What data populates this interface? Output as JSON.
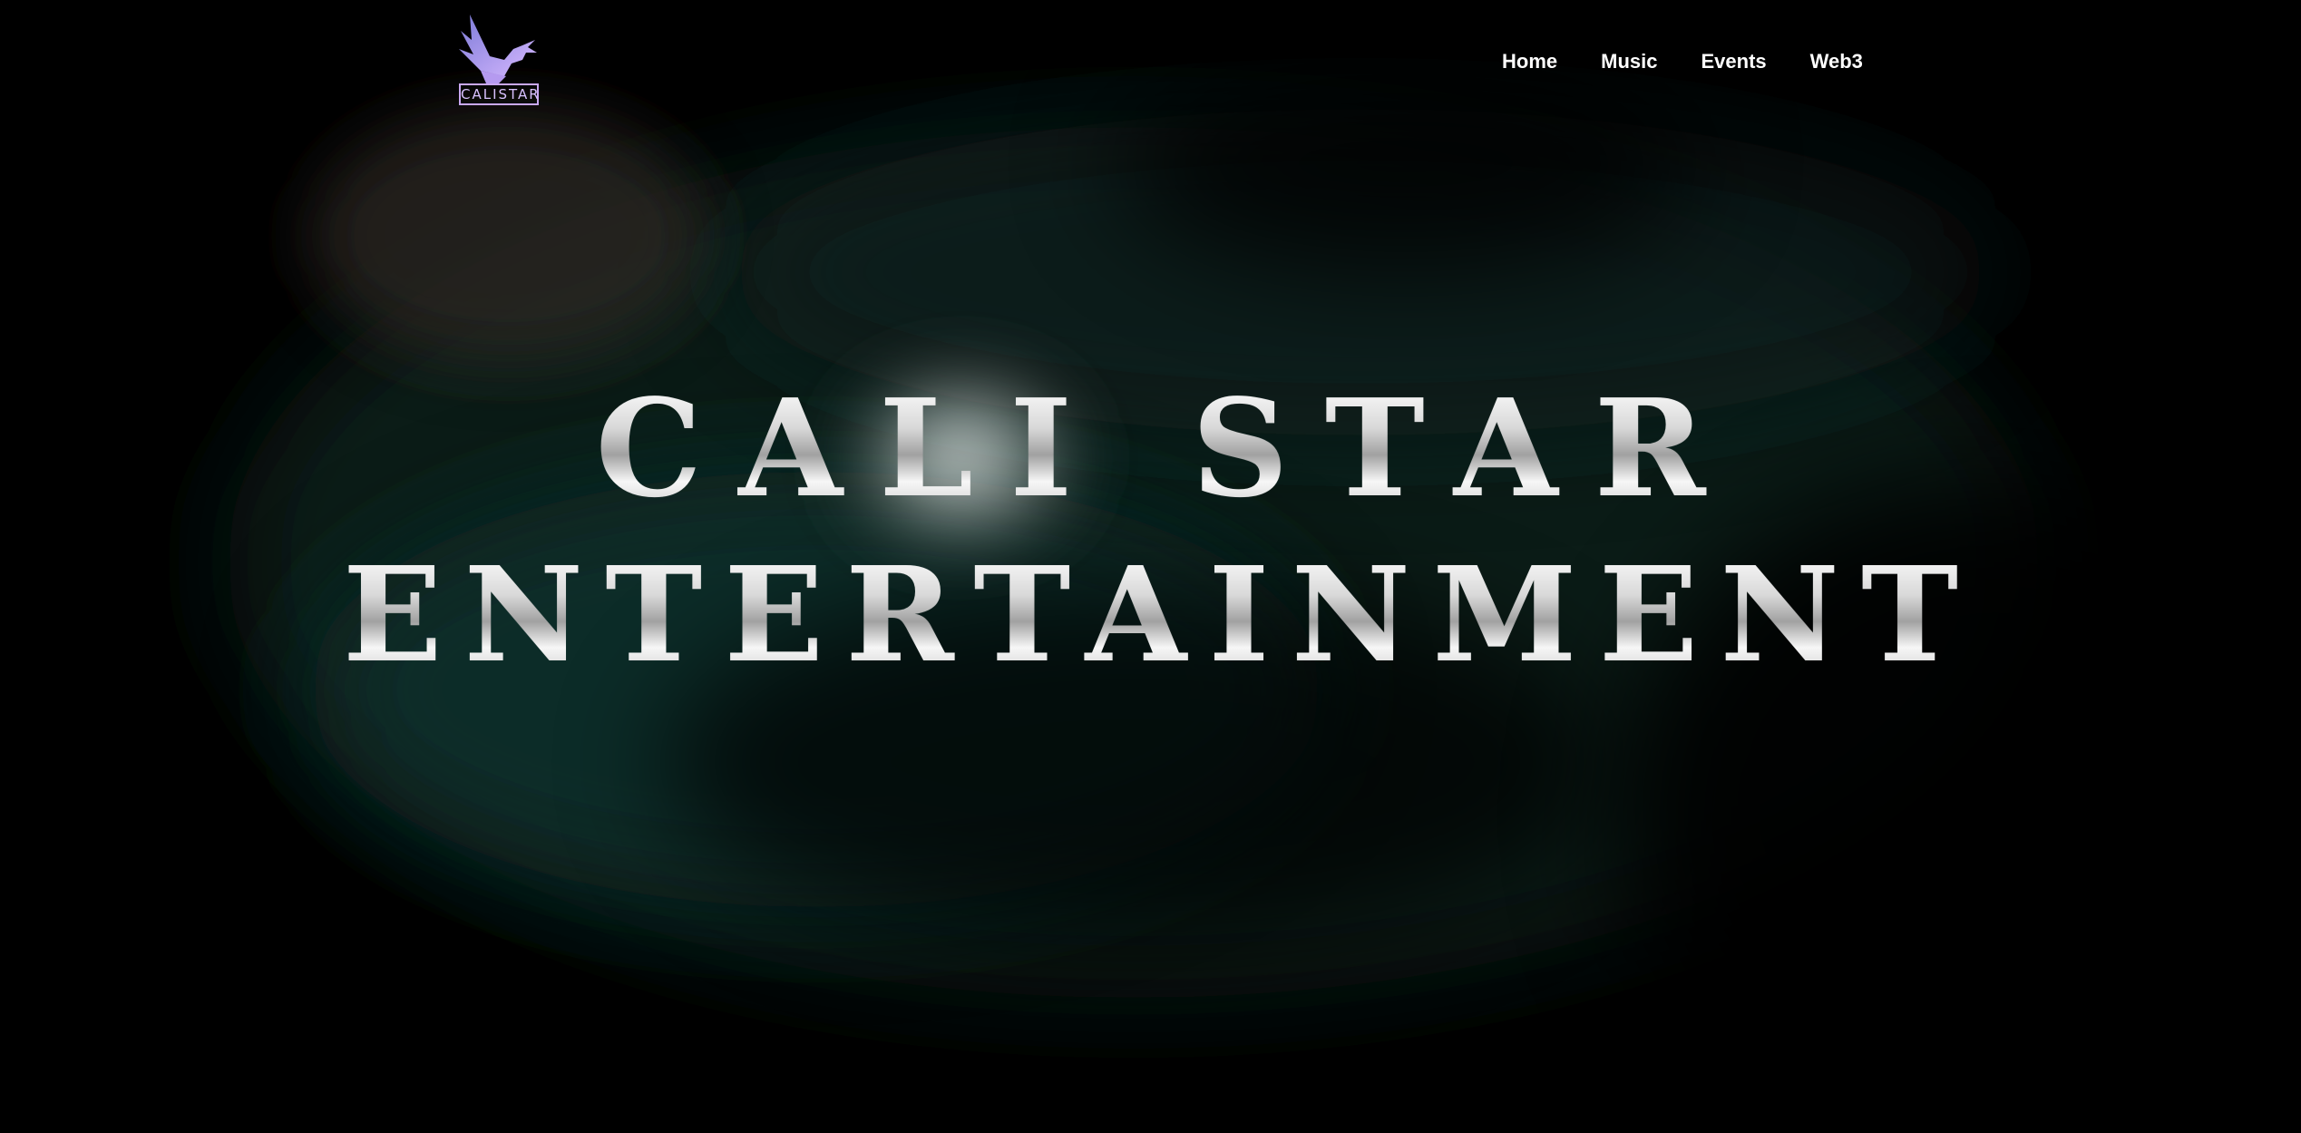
{
  "header": {
    "logo_text": "CALISTAR",
    "nav": [
      {
        "label": "Home"
      },
      {
        "label": "Music"
      },
      {
        "label": "Events"
      },
      {
        "label": "Web3"
      }
    ]
  },
  "hero": {
    "line1": "CALI STAR",
    "line2": "ENTERTAINMENT"
  },
  "colors": {
    "background": "#000000",
    "nav_text": "#ffffff",
    "logo_accent": "#c9a8f2",
    "smoke_teal": "#0f3a34",
    "title_silver": "#d8d8d8"
  }
}
